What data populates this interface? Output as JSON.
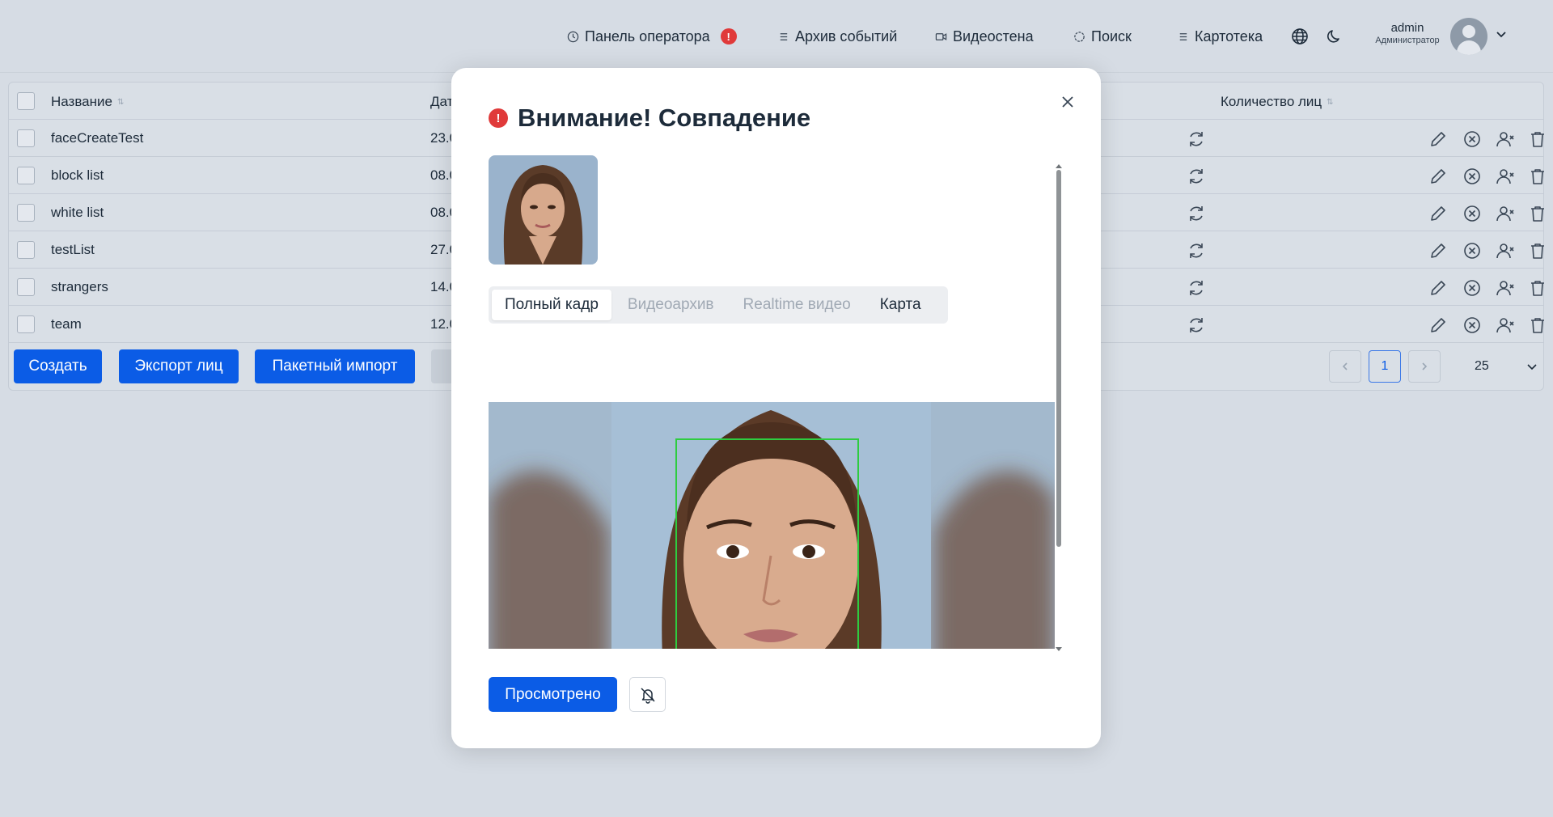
{
  "nav": {
    "operator_panel": "Панель оператора",
    "operator_alert": "!",
    "events_archive": "Архив событий",
    "video_wall": "Видеостена",
    "search": "Поиск",
    "card_index": "Картотека"
  },
  "user": {
    "name": "admin",
    "role": "Администратор"
  },
  "table": {
    "headers": {
      "name": "Название",
      "date": "Дат",
      "faces_count": "Количество лиц"
    },
    "rows": [
      {
        "name": "faceCreateTest",
        "date": "23.0"
      },
      {
        "name": "block list",
        "date": "08.0"
      },
      {
        "name": "white list",
        "date": "08.0"
      },
      {
        "name": "testList",
        "date": "27.0"
      },
      {
        "name": "strangers",
        "date": "14.0"
      },
      {
        "name": "team",
        "date": "12.0"
      }
    ],
    "buttons": {
      "create": "Создать",
      "export": "Экспорт лиц",
      "batch_import": "Пакетный импорт"
    },
    "pagination": {
      "current_page": "1",
      "per_page": "25"
    }
  },
  "modal": {
    "title": "Внимание! Совпадение",
    "title_alert": "!",
    "tabs": [
      {
        "label": "Полный кадр",
        "state": "active"
      },
      {
        "label": "Видеоархив",
        "state": "disabled"
      },
      {
        "label": "Realtime видео",
        "state": "disabled"
      },
      {
        "label": "Карта",
        "state": "enabled"
      }
    ],
    "viewed_button": "Просмотрено"
  },
  "colors": {
    "accent": "#0b5ce6",
    "alert": "#e03a3a",
    "detection_box": "#2ecc40"
  },
  "icons": [
    "clock-icon",
    "list-icon",
    "camera-icon",
    "target-icon",
    "globe-icon",
    "moon-icon",
    "refresh-icon",
    "edit-icon",
    "block-icon",
    "remove-person-icon",
    "trash-icon",
    "close-icon",
    "bell-off-icon"
  ]
}
